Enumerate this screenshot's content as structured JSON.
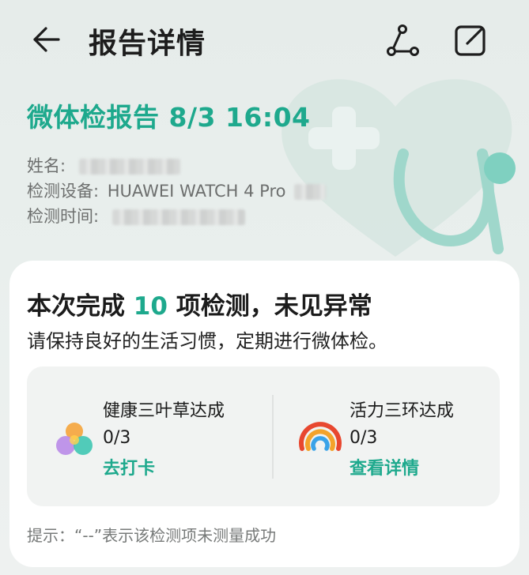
{
  "header": {
    "title": "报告详情",
    "back_icon": "arrow-left-icon",
    "share_icon": "share-route-icon",
    "edit_icon": "edit-square-icon"
  },
  "report": {
    "title_prefix": "微体检报告",
    "datetime": "8/3 16:04",
    "name_label": "姓名:",
    "device_label": "检测设备:",
    "device_value": "HUAWEI WATCH 4 Pro",
    "time_label": "检测时间:"
  },
  "card": {
    "summary_pre": "本次完成",
    "summary_count": "10",
    "summary_post": "项检测，未见异常",
    "advice": "请保持良好的生活习惯，定期进行微体检。",
    "items": [
      {
        "name": "健康三叶草达成",
        "progress": "0/3",
        "link": "去打卡",
        "icon": "clover-icon"
      },
      {
        "name": "活力三环达成",
        "progress": "0/3",
        "link": "查看详情",
        "icon": "rings-icon"
      }
    ],
    "hint": "提示：“--”表示该检测项未测量成功"
  },
  "colors": {
    "accent": "#1ea98d",
    "background": "#e8eeec",
    "card": "#ffffff"
  }
}
